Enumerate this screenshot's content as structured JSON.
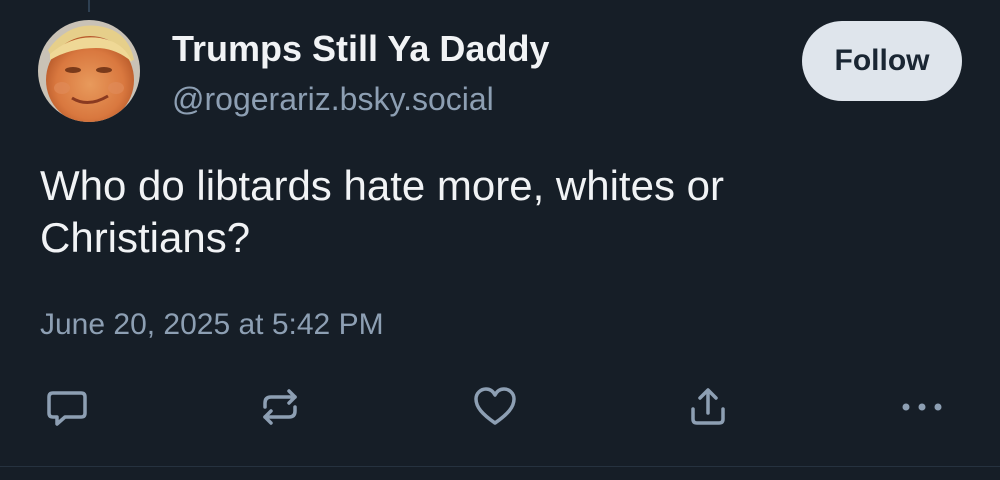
{
  "post": {
    "author": {
      "display_name": "Trumps Still Ya Daddy",
      "handle": "@rogerariz.bsky.social",
      "avatar_icon": "profile-avatar"
    },
    "follow_label": "Follow",
    "text": "Who do libtards hate more, whites or Christians?",
    "timestamp": "June 20, 2025 at 5:42 PM"
  },
  "actions": [
    {
      "name": "reply",
      "icon": "comment-icon"
    },
    {
      "name": "repost",
      "icon": "repost-icon"
    },
    {
      "name": "like",
      "icon": "heart-icon"
    },
    {
      "name": "share",
      "icon": "share-icon"
    },
    {
      "name": "more",
      "icon": "more-icon"
    }
  ],
  "colors": {
    "background": "#161e27",
    "primary_text": "#f1f3f5",
    "secondary_text": "#8d9fb3",
    "follow_button_bg": "#dfe5ec",
    "icon_color": "#8d9fb3"
  }
}
